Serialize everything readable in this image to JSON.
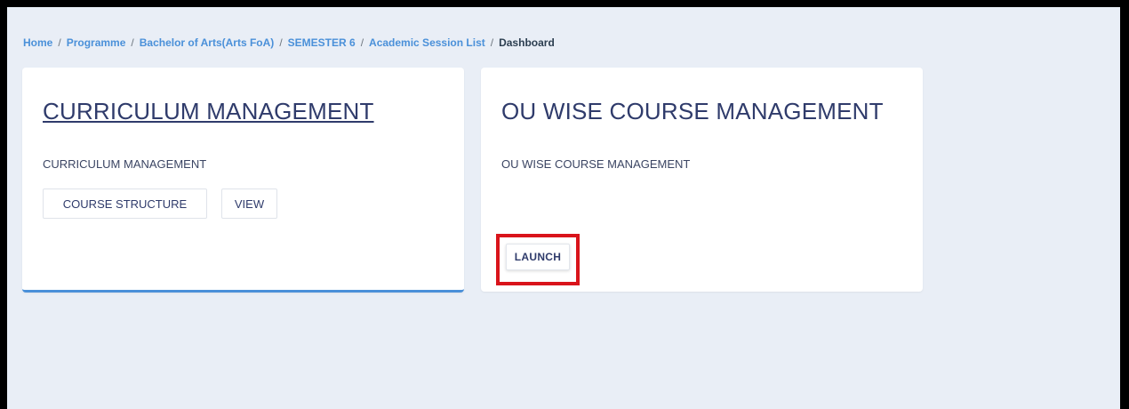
{
  "breadcrumb": {
    "items": [
      "Home",
      "Programme",
      "Bachelor of Arts(Arts FoA)",
      "SEMESTER 6",
      "Academic Session List"
    ],
    "separator": "/",
    "current": "Dashboard"
  },
  "cards": [
    {
      "title": "CURRICULUM MANAGEMENT",
      "description": "CURRICULUM MANAGEMENT",
      "buttons": [
        "COURSE STRUCTURE",
        "VIEW"
      ]
    },
    {
      "title": "OU WISE COURSE MANAGEMENT",
      "description": "OU WISE COURSE MANAGEMENT",
      "buttons": [
        "LAUNCH"
      ]
    }
  ],
  "colors": {
    "accent": "#4a90d9",
    "highlight": "#d9141b",
    "background": "#e9eef6",
    "text": "#2f3b6b"
  }
}
